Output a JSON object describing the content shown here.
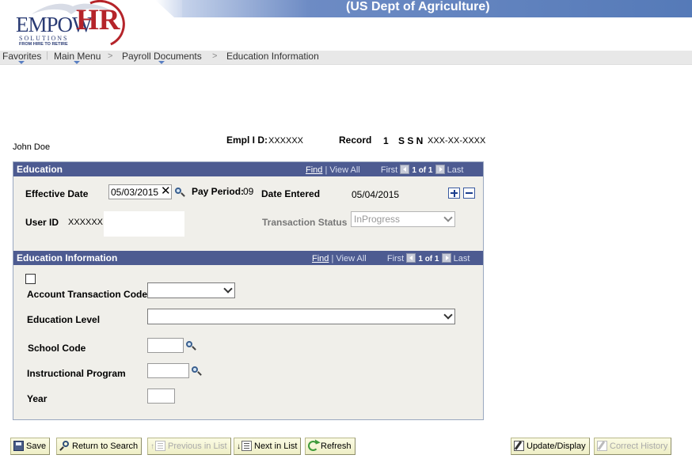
{
  "header": {
    "logo": {
      "empow": "EMPOW",
      "hr": "HR",
      "solutions": "SOLUTIONS",
      "tagline": "FROM HIRE TO RETIRE"
    },
    "org_title": "(US Dept of Agriculture)"
  },
  "nav": {
    "favorites": "Favorites",
    "main_menu": "Main Menu",
    "sep": ">",
    "payroll_documents": "Payroll Documents",
    "current": "Education Information"
  },
  "employee": {
    "name": "John Doe",
    "empl_id_label": "Empl I D:",
    "empl_id": "XXXXXX",
    "record_label": "Record",
    "record": "1",
    "ssn_label": "S S N",
    "ssn": "XXX-XX-XXXX"
  },
  "education_panel": {
    "title": "Education",
    "find": "Find",
    "view_all": "View All",
    "first": "First",
    "count": "1 of 1",
    "last": "Last",
    "effective_date_label": "Effective Date",
    "effective_date": "05/03/2015",
    "pay_period_label": "Pay Period:",
    "pay_period": "09",
    "date_entered_label": "Date Entered",
    "date_entered": "05/04/2015",
    "user_id_label": "User ID",
    "user_id": "XXXXXX",
    "transaction_status_label": "Transaction Status",
    "transaction_status": "InProgress"
  },
  "education_info_panel": {
    "title": "Education Information",
    "find": "Find",
    "view_all": "View All",
    "first": "First",
    "count": "1 of 1",
    "last": "Last",
    "account_transaction_code_label": "Account Transaction Code",
    "account_transaction_code": "",
    "education_level_label": "Education Level",
    "education_level": "",
    "school_code_label": "School Code",
    "school_code": "",
    "instructional_program_label": "Instructional Program",
    "instructional_program": "",
    "year_label": "Year",
    "year": ""
  },
  "toolbar": {
    "save": "Save",
    "return_to_search": "Return to Search",
    "previous_in_list": "Previous in List",
    "next_in_list": "Next in List",
    "refresh": "Refresh",
    "update_display": "Update/Display",
    "correct_history": "Correct History"
  }
}
